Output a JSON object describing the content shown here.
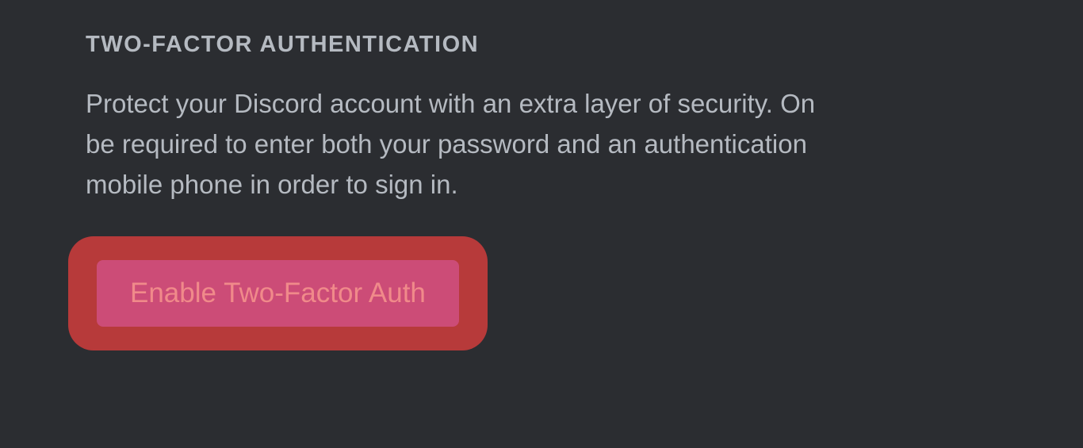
{
  "section": {
    "heading": "TWO-FACTOR AUTHENTICATION",
    "description": "Protect your Discord account with an extra layer of security. On\nbe required to enter both your password and an authentication\nmobile phone in order to sign in.",
    "button_label": "Enable Two-Factor Auth"
  }
}
